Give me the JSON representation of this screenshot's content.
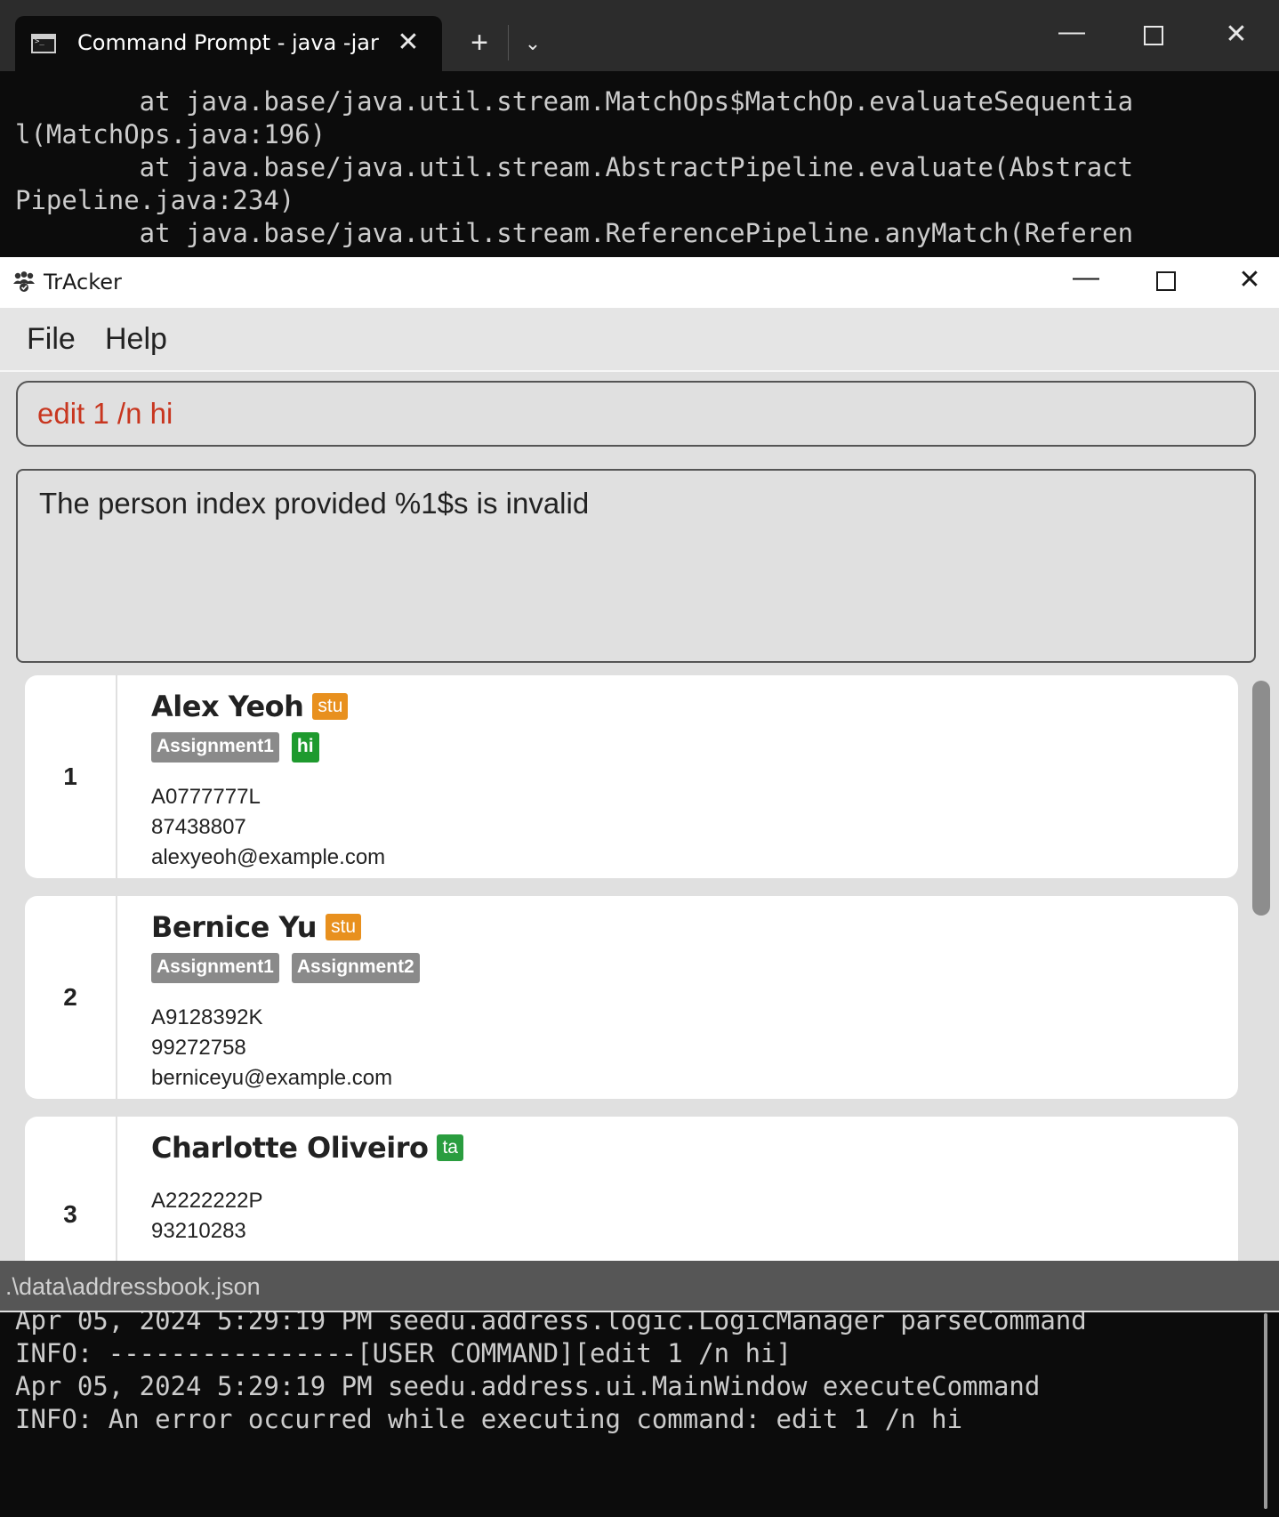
{
  "terminal": {
    "tab_title": "Command Prompt - java  -jar",
    "top_lines": [
      "        at java.base/java.util.stream.MatchOps$MatchOp.evaluateSequentia",
      "l(MatchOps.java:196)",
      "        at java.base/java.util.stream.AbstractPipeline.evaluate(Abstract",
      "Pipeline.java:234)",
      "        at java.base/java.util.stream.ReferencePipeline.anyMatch(Referen"
    ],
    "bottom_lines": [
      "Apr 05, 2024 5:29:19 PM seedu.address.logic.LogicManager parseCommand",
      "INFO: ----------------[USER COMMAND][edit 1 /n hi]",
      "Apr 05, 2024 5:29:19 PM seedu.address.ui.MainWindow executeCommand",
      "INFO: An error occurred while executing command: edit 1 /n hi"
    ]
  },
  "app": {
    "title": "TrAcker",
    "menu": [
      "File",
      "Help"
    ],
    "command_input": "edit 1 /n hi",
    "result_message": "The person index provided %1$s is invalid",
    "status_path": ".\\data\\addressbook.json"
  },
  "persons": [
    {
      "index": "1",
      "name": "Alex Yeoh",
      "role": "stu",
      "tags": [
        {
          "label": "Assignment1",
          "color": "#8a8a8a"
        },
        {
          "label": "hi",
          "color": "#1e9a2e"
        }
      ],
      "id": "A0777777L",
      "phone": "87438807",
      "email": "alexyeoh@example.com"
    },
    {
      "index": "2",
      "name": "Bernice Yu",
      "role": "stu",
      "tags": [
        {
          "label": "Assignment1",
          "color": "#8a8a8a"
        },
        {
          "label": "Assignment2",
          "color": "#8a8a8a"
        }
      ],
      "id": "A9128392K",
      "phone": "99272758",
      "email": "berniceyu@example.com"
    },
    {
      "index": "3",
      "name": "Charlotte Oliveiro",
      "role": "ta",
      "tags": [],
      "id": "A2222222P",
      "phone": "93210283"
    }
  ],
  "colors": {
    "command_error_text": "#c8361f",
    "role_stu": "#e8901e",
    "role_ta": "#2a9d3f",
    "terminal_bg": "#0c0c0c"
  },
  "icons": {
    "terminal_tab": "command-prompt-icon",
    "app": "people-icon"
  }
}
